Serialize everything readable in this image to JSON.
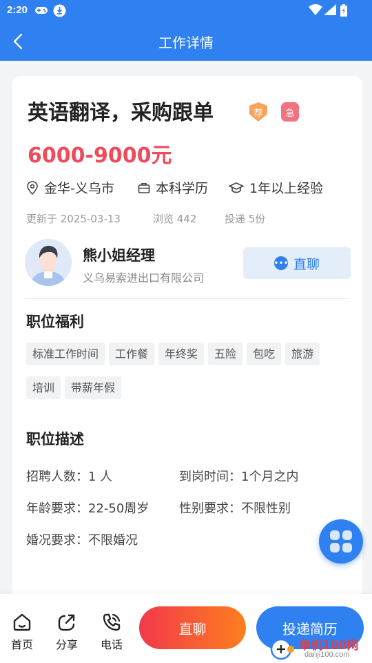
{
  "status_bar": {
    "time": "2:20"
  },
  "nav": {
    "title": "工作详情"
  },
  "job": {
    "title": "英语翻译，采购跟单",
    "badge_recommend": "荐",
    "badge_urgent": "急",
    "salary": "6000-9000元",
    "location": "金华-义乌市",
    "education": "本科学历",
    "experience": "1年以上经验",
    "updated": "更新于 2025-03-13",
    "views": "浏览 442",
    "applications": "投递 5份"
  },
  "recruiter": {
    "name": "熊小姐经理",
    "company": "义乌易索进出口有限公司",
    "chat_label": "直聊"
  },
  "benefits": {
    "title": "职位福利",
    "tags": [
      "标准工作时间",
      "工作餐",
      "年终奖",
      "五险",
      "包吃",
      "旅游",
      "培训",
      "带薪年假"
    ]
  },
  "description": {
    "title": "职位描述",
    "headcount": "招聘人数：1 人",
    "start_time": "到岗时间：1个月之内",
    "age": "年龄要求：22-50周岁",
    "gender": "性别要求：不限性别",
    "marital": "婚况要求：不限婚况"
  },
  "bottom_bar": {
    "home": "首页",
    "share": "分享",
    "phone": "电话",
    "chat": "直聊",
    "apply": "投递简历"
  },
  "watermark": {
    "name": "单机100网",
    "url": "danji100.com"
  },
  "colors": {
    "primary": "#2f80f0",
    "salary": "#ee4b5b",
    "chat_gradient_start": "#f2394a",
    "chat_gradient_end": "#fe7e1e"
  }
}
